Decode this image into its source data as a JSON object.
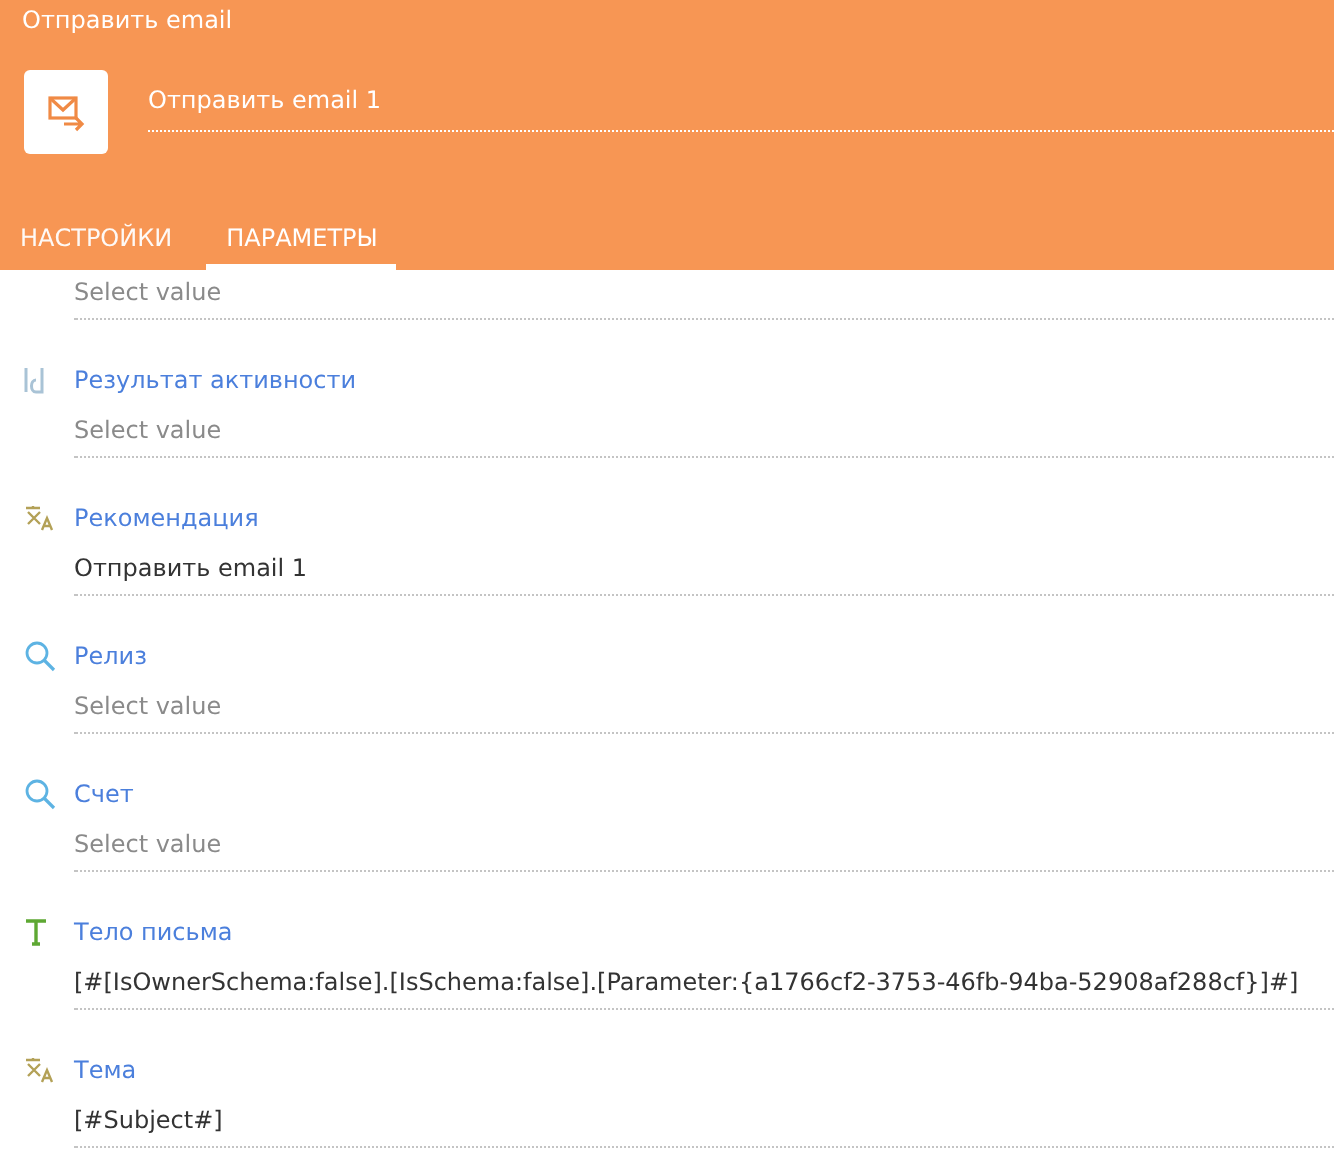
{
  "header": {
    "title": "Отправить email",
    "name_value": "Отправить email 1"
  },
  "tabs": [
    {
      "label": "НАСТРОЙКИ",
      "selected": false
    },
    {
      "label": "ПАРАМЕТРЫ",
      "selected": true
    }
  ],
  "fields": [
    {
      "kind": "partial",
      "placeholder": "Select value"
    },
    {
      "kind": "id",
      "label": "Результат активности",
      "placeholder": "Select value"
    },
    {
      "kind": "localizable",
      "label": "Рекомендация",
      "value": "Отправить email 1"
    },
    {
      "kind": "lookup",
      "label": "Релиз",
      "placeholder": "Select value"
    },
    {
      "kind": "lookup",
      "label": "Счет",
      "placeholder": "Select value"
    },
    {
      "kind": "text",
      "label": "Тело письма",
      "value": "[#[IsOwnerSchema:false].[IsSchema:false].[Parameter:{a1766cf2-3753-46fb-94ba-52908af288cf}]#]"
    },
    {
      "kind": "localizable",
      "label": "Тема",
      "value": "[#Subject#]"
    }
  ]
}
